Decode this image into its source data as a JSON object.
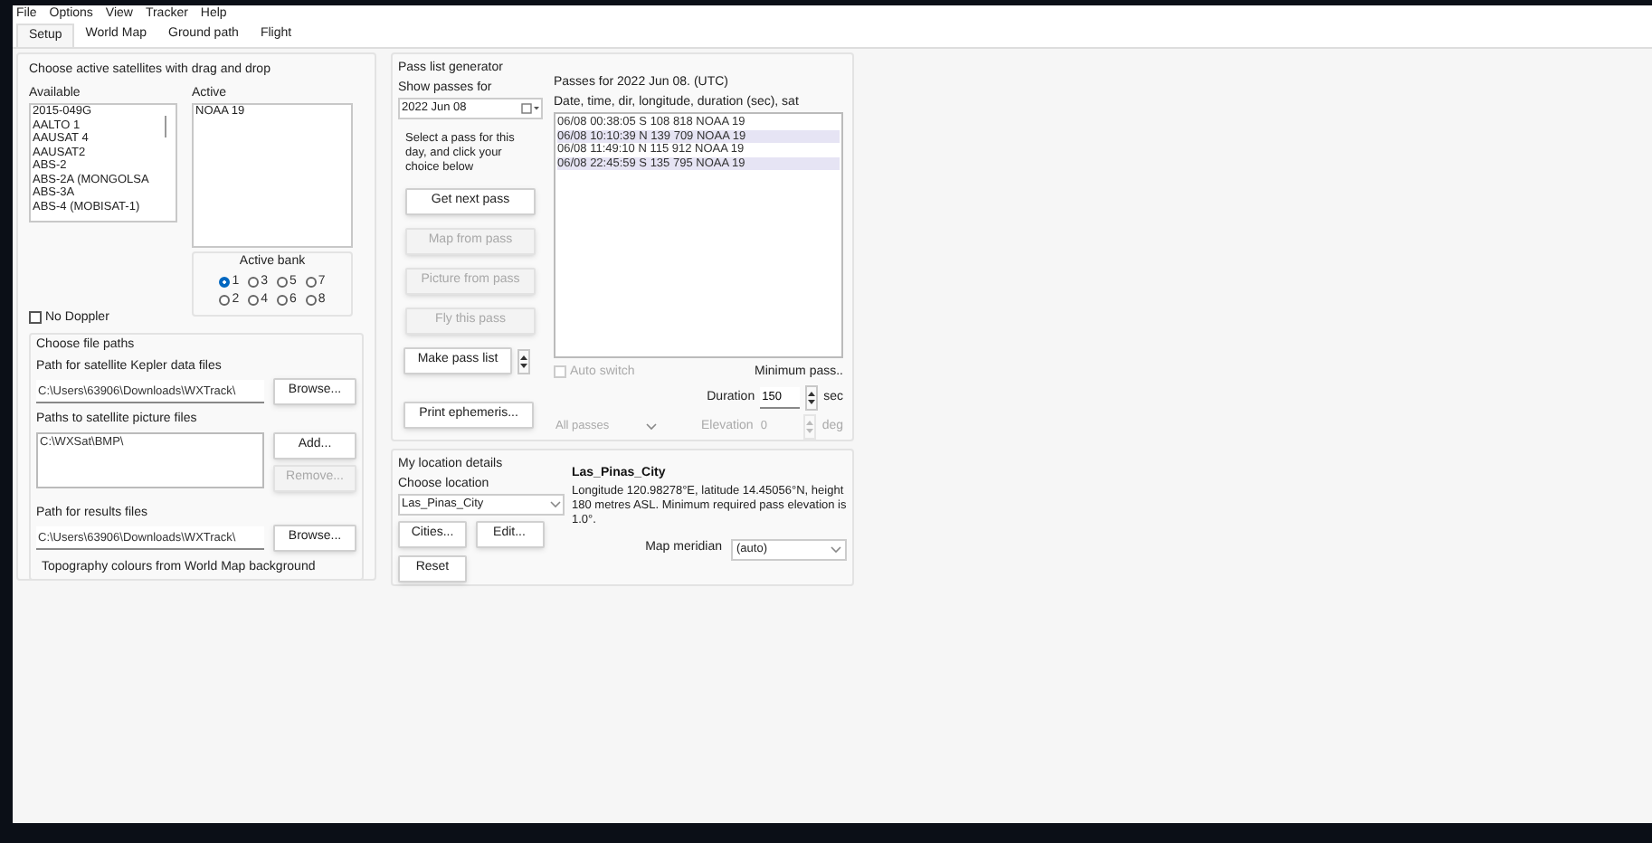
{
  "menu": [
    "File",
    "Options",
    "View",
    "Tracker",
    "Help"
  ],
  "tabs": [
    {
      "label": "Setup",
      "selected": true
    },
    {
      "label": "World Map",
      "selected": false
    },
    {
      "label": "Ground path",
      "selected": false
    },
    {
      "label": "Flight",
      "selected": false
    }
  ],
  "satellites": {
    "title": "Choose active satellites with drag and drop",
    "available": {
      "label": "Available",
      "items": [
        "2015-049G",
        "AALTO 1",
        "AAUSAT 4",
        "AAUSAT2",
        "ABS-2",
        "ABS-2A (MONGOLSA",
        "ABS-3A",
        "ABS-4 (MOBISAT-1)"
      ]
    },
    "active": {
      "label": "Active",
      "items": [
        "NOAA 19"
      ]
    },
    "bank": {
      "label": "Active bank",
      "options": [
        {
          "label": "1",
          "selected": true
        },
        {
          "label": "3",
          "selected": false
        },
        {
          "label": "5",
          "selected": false
        },
        {
          "label": "7",
          "selected": false
        },
        {
          "label": "2",
          "selected": false
        },
        {
          "label": "4",
          "selected": false
        },
        {
          "label": "6",
          "selected": false
        },
        {
          "label": "8",
          "selected": false
        }
      ]
    },
    "no_doppler": {
      "label": "No Doppler",
      "checked": false
    }
  },
  "file_paths": {
    "title": "Choose file paths",
    "kepler": {
      "label": "Path for satellite Kepler data files",
      "value": "C:\\Users\\63906\\Downloads\\WXTrack\\",
      "button": "Browse..."
    },
    "pictures": {
      "label": "Paths to satellite picture files",
      "items": [
        "C:\\WXSat\\BMP\\"
      ],
      "buttons": [
        {
          "label": "Add...",
          "disabled": false
        },
        {
          "label": "Remove...",
          "disabled": true
        }
      ]
    },
    "results": {
      "label": "Path for results files",
      "value": "C:\\Users\\63906\\Downloads\\WXTrack\\",
      "button": "Browse..."
    },
    "topography": "Topography colours from World Map background"
  },
  "pass_generator": {
    "title": "Pass list generator",
    "show_for": "Show passes for",
    "date": "2022 Jun 08",
    "instruction": "Select a pass for this day, and click your choice below",
    "buttons": [
      {
        "label": "Get next pass",
        "disabled": false
      },
      {
        "label": "Map from pass",
        "disabled": true
      },
      {
        "label": "Picture from pass",
        "disabled": true
      },
      {
        "label": "Fly this pass",
        "disabled": true
      }
    ],
    "make_pass_list": "Make pass list",
    "print_ephemeris": "Print ephemeris...",
    "passes_title": "Passes for 2022 Jun 08. (UTC)",
    "columns_label": "Date, time, dir, longitude, duration (sec), sat",
    "passes": [
      {
        "text": "06/08 00:38:05 S 108 818 NOAA 19",
        "selected": false
      },
      {
        "text": "06/08 10:10:39 N 139 709 NOAA 19",
        "selected": true
      },
      {
        "text": "06/08 11:49:10 N 115 912 NOAA 19",
        "selected": false
      },
      {
        "text": "06/08 22:45:59 S 135 795 NOAA 19",
        "selected": true
      }
    ],
    "auto_switch": {
      "label": "Auto switch",
      "checked": false,
      "disabled": true
    },
    "minimum_label": "Minimum pass..",
    "duration": {
      "label": "Duration",
      "value": "150",
      "unit": "sec"
    },
    "filter": {
      "value": "All passes",
      "disabled": true
    },
    "elevation": {
      "label": "Elevation",
      "value": "0",
      "unit": "deg",
      "disabled": true
    }
  },
  "location": {
    "title": "My location details",
    "choose_label": "Choose location",
    "city": "Las_Pinas_City",
    "buttons": [
      "Cities...",
      "Edit...",
      "Reset"
    ],
    "name": "Las_Pinas_City",
    "description": "Longitude 120.98278°E, latitude 14.45056°N, height 180 metres ASL. Minimum required pass elevation is 1.0°.",
    "meridian": {
      "label": "Map meridian",
      "value": "(auto)"
    }
  }
}
